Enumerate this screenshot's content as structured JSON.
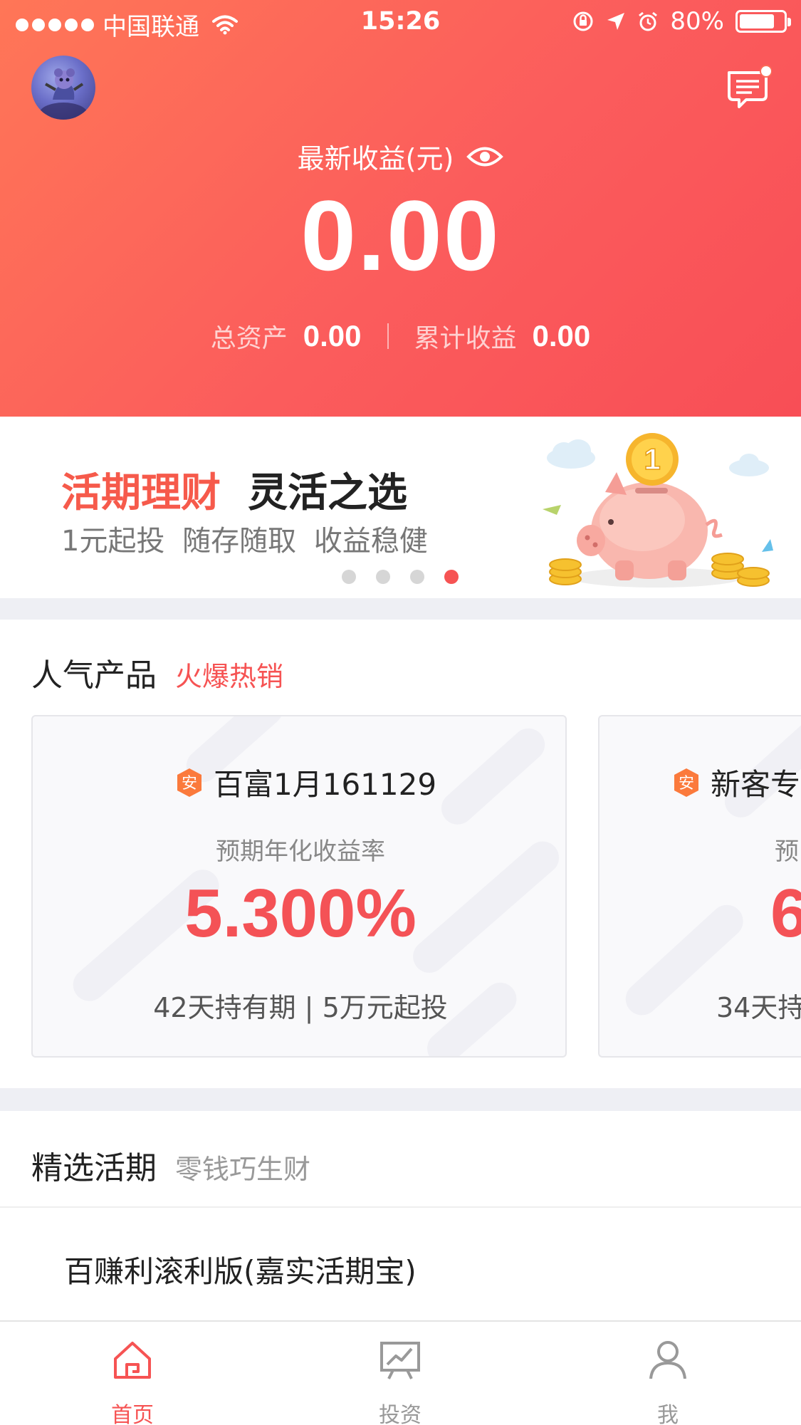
{
  "status_bar": {
    "carrier": "中国联通",
    "time": "15:26",
    "battery": "80%",
    "battery_level": 0.8,
    "icons": [
      "signal-dots-icon",
      "wifi-icon",
      "orientation-lock-icon",
      "location-arrow-icon",
      "alarm-icon",
      "battery-icon"
    ]
  },
  "header": {
    "avatar_icon": "user-avatar",
    "message_icon": "message-icon",
    "earnings_label": "最新收益(元)",
    "visibility_icon": "eye-icon",
    "earnings_value": "0.00",
    "total_assets_label": "总资产",
    "total_assets_value": "0.00",
    "cumulative_label": "累计收益",
    "cumulative_value": "0.00",
    "gradient_colors": [
      "#ff7657",
      "#f84e56"
    ]
  },
  "banner": {
    "title_highlight": "活期理财",
    "title_rest": "灵活之选",
    "subtitle": "1元起投 随存随取 收益稳健",
    "page_count": 4,
    "active_page": 4,
    "illustration": "piggy-bank-illustration",
    "coin_label": "1"
  },
  "popular": {
    "title": "人气产品",
    "tag": "火爆热销",
    "badge_char": "安",
    "cards": [
      {
        "name": "百富1月161129",
        "rate_label": "预期年化收益率",
        "rate": "5.300%",
        "meta": "42天持有期 | 5万元起投"
      },
      {
        "name": "新客专",
        "rate_label": "预",
        "rate": "6",
        "meta": "34天持"
      }
    ]
  },
  "selected": {
    "title": "精选活期",
    "tag": "零钱巧生财",
    "items": [
      "百赚利滚利版(嘉实活期宝)"
    ]
  },
  "tabbar": {
    "tabs": [
      {
        "label": "首页",
        "icon": "home-icon",
        "active": true
      },
      {
        "label": "投资",
        "icon": "chart-icon",
        "active": false
      },
      {
        "label": "我",
        "icon": "profile-icon",
        "active": false
      }
    ]
  },
  "colors": {
    "accent": "#f65353",
    "rate_red": "#f45256",
    "divider_gray": "#eeeff4"
  }
}
